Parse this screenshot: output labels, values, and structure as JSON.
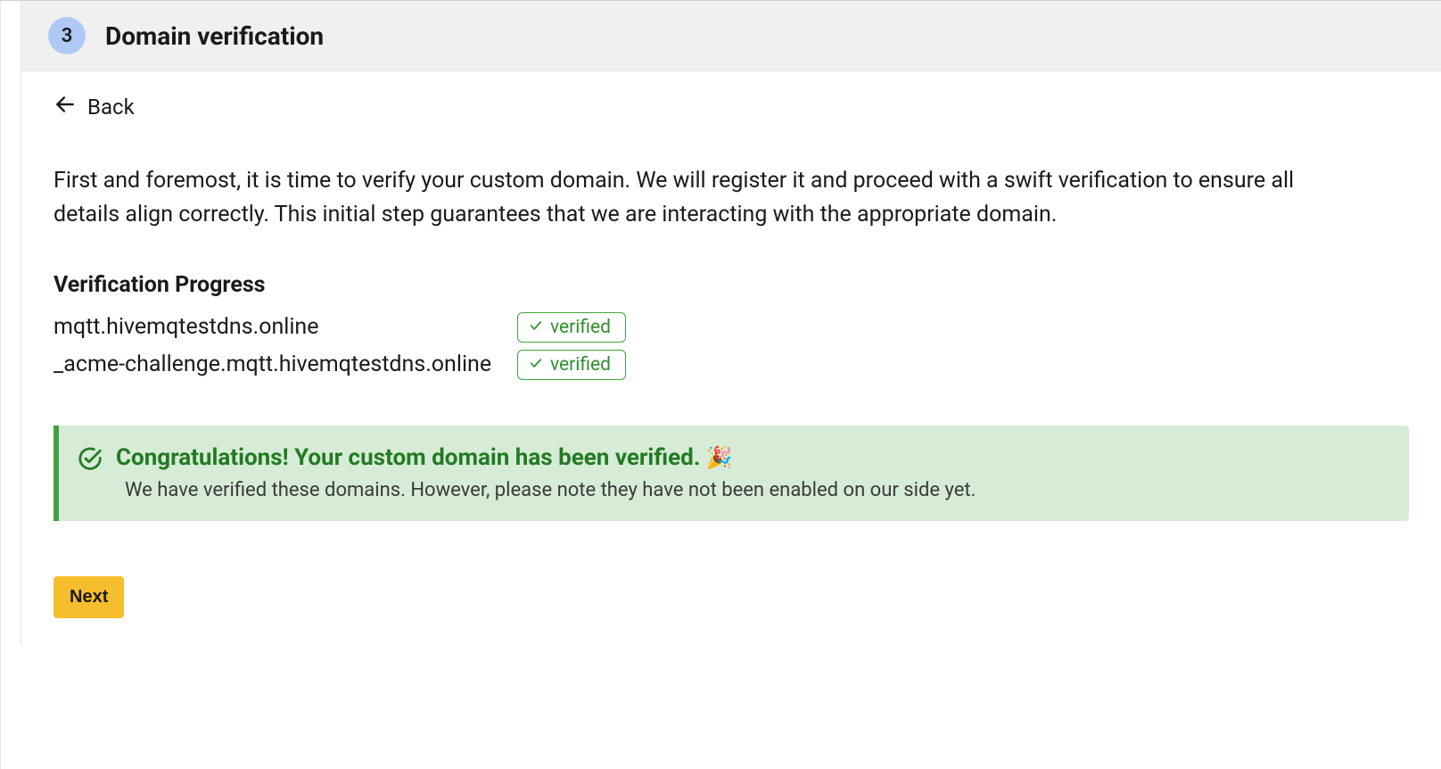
{
  "header": {
    "step_number": "3",
    "title": "Domain verification"
  },
  "back_label": "Back",
  "intro": "First and foremost, it is time to verify your custom domain. We will register it and proceed with a swift verification to ensure all details align correctly. This initial step guarantees that we are interacting with the appropriate domain.",
  "progress": {
    "heading": "Verification Progress",
    "rows": [
      {
        "domain": "mqtt.hivemqtestdns.online",
        "status": "verified"
      },
      {
        "domain": "_acme-challenge.mqtt.hivemqtestdns.online",
        "status": "verified"
      }
    ]
  },
  "banner": {
    "title": "Congratulations! Your custom domain has been verified.",
    "emoji": "🎉",
    "subtitle": "We have verified these domains. However, please note they have not been enabled on our side yet."
  },
  "next_label": "Next"
}
